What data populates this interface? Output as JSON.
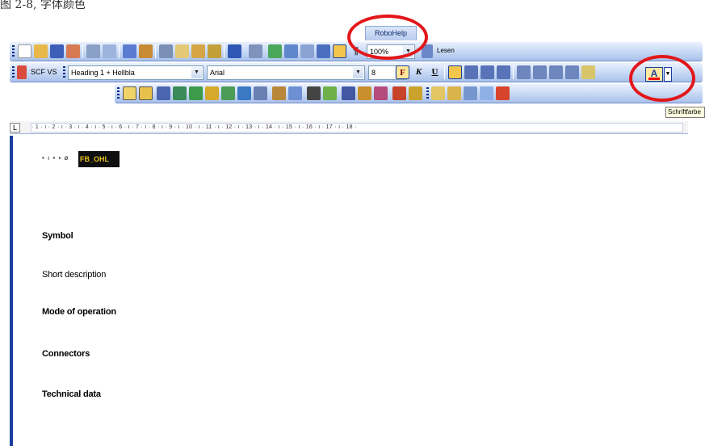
{
  "caption": "图 2-8, 字体颜色",
  "robohelp_tab": "RoboHelp",
  "toolbar_standard": {
    "zoom": "100%",
    "read_button": "Lesen",
    "pilcrow": "¶"
  },
  "toolbar_formatting": {
    "style_pane_label": "SCF VS",
    "style": "Heading 1 + Hellbla",
    "font": "Arial",
    "font_size": "8",
    "bold": "F",
    "italic": "K",
    "underline": "U",
    "font_color_button": "A"
  },
  "tooltip": "Schriftfarbe",
  "ruler": {
    "corner": "L",
    "marks": "· 1 · ı · 2 · ı · 3 · ı · 4 · ı · 5 · ı · 6 · ı · 7 · ı · 8 · ı · 9 · ı · 10 · ı · 11 · ı · 12 · ı · 13 · ı · 14 · ı · 15 · ı · 16 · ı · 17 · ı · 18 ·"
  },
  "document": {
    "field_marks": "• ı • • ø",
    "fb_tag": "FB_OHL",
    "lines": {
      "symbol": "Symbol",
      "short_description": "Short description",
      "mode_of_operation": "Mode of operation",
      "connectors": "Connectors",
      "technical_data": "Technical data"
    }
  },
  "colors": {
    "highlight_circle": "#e2171a",
    "fb_tag_text": "#e8c21f",
    "fb_tag_background": "#0f0f0f",
    "toolbar_blue": "#c5d7f4"
  }
}
